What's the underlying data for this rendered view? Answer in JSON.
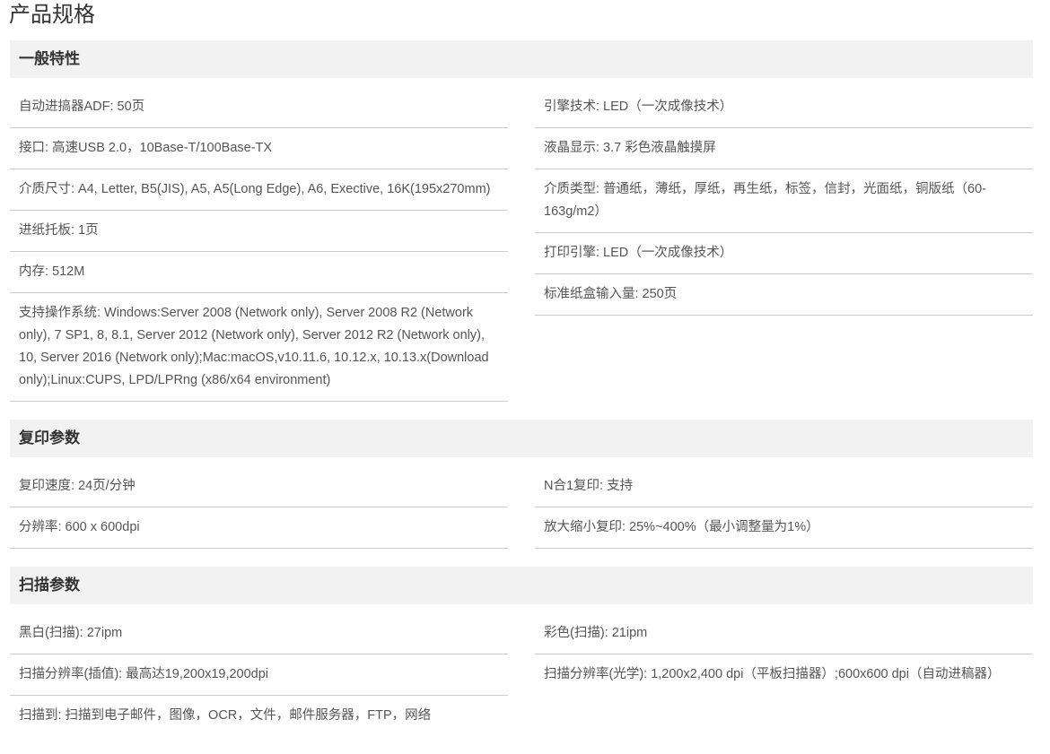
{
  "page_title": "产品规格",
  "sections": [
    {
      "title": "一般特性",
      "left": [
        "自动进搞器ADF: 50页",
        "接口: 高速USB 2.0，10Base-T/100Base-TX",
        "介质尺寸: A4, Letter, B5(JIS), A5, A5(Long Edge), A6, Exective, 16K(195x270mm)",
        "进纸托板: 1页",
        "内存: 512M",
        "支持操作系统: Windows:Server 2008 (Network only), Server 2008 R2 (Network only), 7 SP1, 8, 8.1, Server 2012 (Network only), Server 2012 R2 (Network only), 10, Server 2016 (Network only);Mac:macOS,v10.11.6, 10.12.x, 10.13.x(Download only);Linux:CUPS, LPD/LPRng (x86/x64 environment)"
      ],
      "right": [
        "引擎技术: LED（一次成像技术）",
        "液晶显示: 3.7 彩色液晶触摸屏",
        "介质类型: 普通纸，薄纸，厚纸，再生纸，标签，信封，光面纸，铜版纸（60-163g/m2）",
        "打印引擎: LED（一次成像技术）",
        "标准纸盒输入量: 250页"
      ]
    },
    {
      "title": "复印参数",
      "left": [
        "复印速度: 24页/分钟",
        "分辨率: 600 x 600dpi"
      ],
      "right": [
        "N合1复印: 支持",
        "放大缩小复印: 25%~400%（最小调整量为1%）"
      ]
    },
    {
      "title": "扫描参数",
      "left": [
        "黑白(扫描): 27ipm",
        "扫描分辨率(插值): 最高达19,200x19,200dpi",
        "扫描到: 扫描到电子邮件，图像，OCR，文件，邮件服务器，FTP，网络"
      ],
      "right": [
        "彩色(扫描): 21ipm",
        "扫描分辨率(光学): 1,200x2,400 dpi（平板扫描器）;600x600 dpi（自动进稿器）"
      ]
    }
  ]
}
